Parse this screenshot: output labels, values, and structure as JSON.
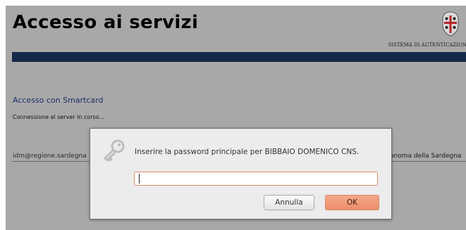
{
  "page": {
    "title": "Accesso ai servizi",
    "system_label": "SISTEMA DI AUTENTICAZIONE",
    "section_heading": "Accesso con Smartcard",
    "status_text": "Connessione al server in corso...",
    "footer_contact": "idm@regione.sardegna",
    "footer_org": "onoma della Sardegna"
  },
  "dialog": {
    "icon": "key-icon",
    "prompt": "Inserire la password principale per BIBBAIO DOMENICO CNS.",
    "password_value": "",
    "cancel_label": "Annulla",
    "ok_label": "OK"
  },
  "colors": {
    "page_background": "#a8a8a8",
    "banner": "#152a4a",
    "heading": "#1b2f6a",
    "dialog_background": "#ececec",
    "ok_button": "#ec8f6b",
    "input_focus_border": "#e38a63"
  }
}
